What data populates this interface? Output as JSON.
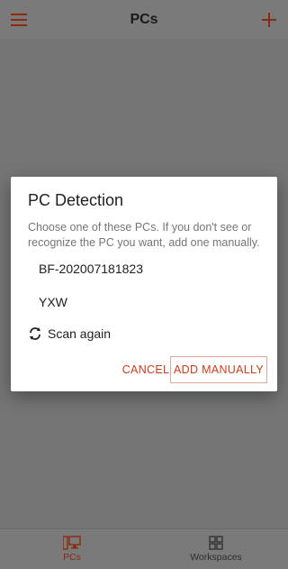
{
  "appbar": {
    "title": "PCs",
    "menu_icon": "hamburger-menu-icon",
    "add_icon": "plus-icon"
  },
  "dialog": {
    "title": "PC Detection",
    "message": "Choose one of these PCs. If you don't see or recognize the PC you want, add one manually.",
    "pcs": [
      "BF-202007181823",
      "YXW"
    ],
    "scan_label": "Scan again",
    "cancel_label": "CANCEL",
    "add_manually_label": "ADD MANUALLY"
  },
  "bottom_nav": {
    "items": [
      {
        "label": "PCs",
        "icon": "pc-icon",
        "active": true
      },
      {
        "label": "Workspaces",
        "icon": "workspaces-icon",
        "active": false
      }
    ]
  },
  "colors": {
    "accent": "#d03b18",
    "overlay": "#757575",
    "dialog_bg": "#ffffff"
  }
}
